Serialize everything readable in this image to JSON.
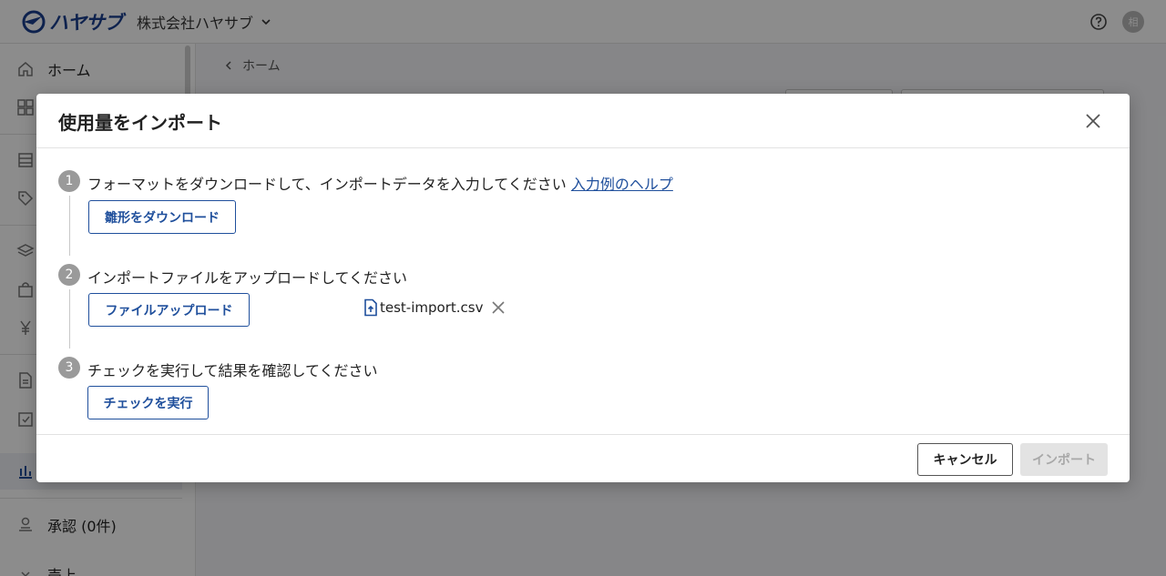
{
  "topbar": {
    "logo_text": "ハヤサブ",
    "company_name": "株式会社ハヤサブ",
    "avatar_initial": "相"
  },
  "sidebar": {
    "items": [
      {
        "label": "ホーム",
        "icon": "home-icon"
      },
      {
        "label": "",
        "icon": "dashboard-icon"
      },
      {
        "label": "",
        "icon": "building-icon"
      },
      {
        "label": "",
        "icon": "tag-icon"
      },
      {
        "label": "",
        "icon": "layers-icon"
      },
      {
        "label": "",
        "icon": "bag-icon"
      },
      {
        "label": "",
        "icon": "yen-icon"
      },
      {
        "label": "",
        "icon": "document-icon"
      },
      {
        "label": "",
        "icon": "clipboard-check-icon"
      },
      {
        "label": "",
        "icon": "bar-chart-icon"
      },
      {
        "label": "承認 (0件)",
        "icon": "stamp-icon"
      },
      {
        "label": "売上",
        "icon": "chevron-down-icon"
      }
    ]
  },
  "content": {
    "breadcrumb": "ホーム"
  },
  "modal": {
    "title": "使用量をインポート",
    "steps": [
      {
        "number": "1",
        "text": "フォーマットをダウンロードして、インポートデータを入力してください",
        "link": "入力例のヘルプ",
        "button": "雛形をダウンロード"
      },
      {
        "number": "2",
        "text": "インポートファイルをアップロードしてください",
        "button": "ファイルアップロード",
        "file_name": "test-import.csv"
      },
      {
        "number": "3",
        "text": "チェックを実行して結果を確認してください",
        "button": "チェックを実行"
      }
    ],
    "footer": {
      "cancel": "キャンセル",
      "import": "インポート"
    }
  },
  "colors": {
    "accent": "#1f4f9c",
    "step_badge": "#9a9a9a",
    "disabled_bg": "#e3e3e3",
    "disabled_text": "#a8a8a8"
  }
}
